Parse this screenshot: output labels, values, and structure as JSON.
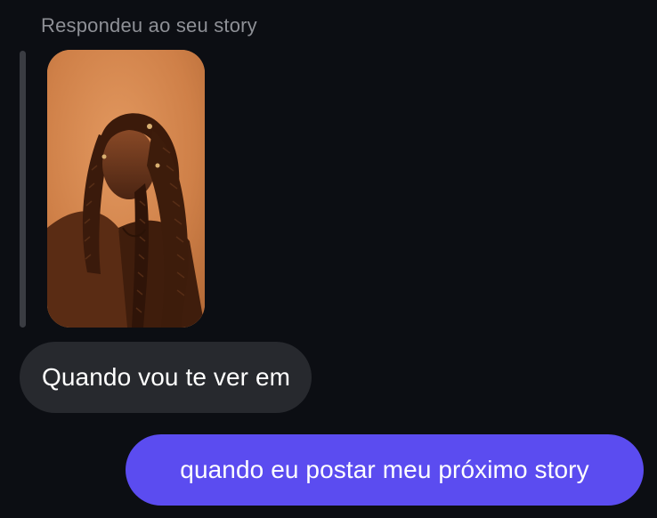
{
  "thread": {
    "reply_caption": "Respondeu ao seu story",
    "story_preview_icon": "story-photo-thumbnail",
    "messages": [
      {
        "direction": "received",
        "text": "Quando vou te ver em"
      },
      {
        "direction": "sent",
        "text": "quando eu postar meu próximo story"
      }
    ]
  },
  "colors": {
    "background": "#0c0e13",
    "received_bubble": "#27292e",
    "sent_bubble": "#5b4cf0",
    "caption_text": "#8e9096",
    "message_text": "#ffffff"
  }
}
